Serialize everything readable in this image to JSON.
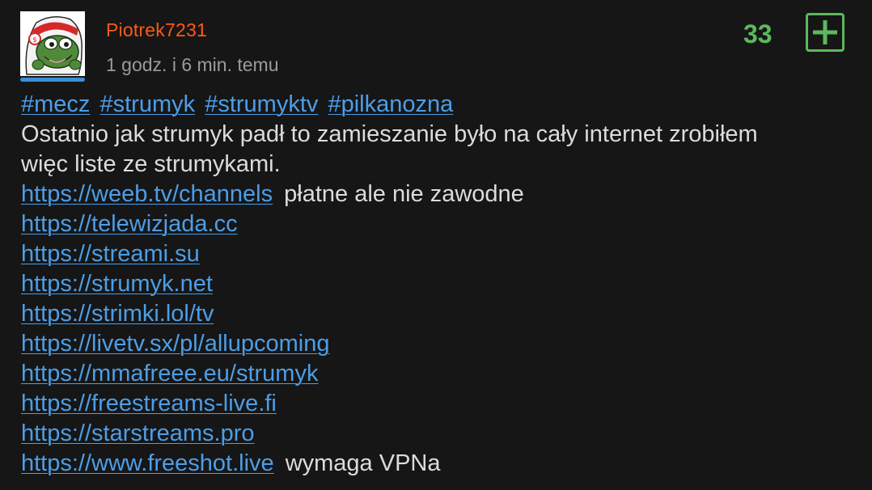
{
  "author": {
    "username": "Piotrek7231",
    "timestamp": "1 godz. i 6 min. temu",
    "avatar_icon": "frog-avatar-icon",
    "username_color": "#ff5917"
  },
  "votes": {
    "count": "33",
    "plus_icon": "plus-icon",
    "color": "#5cb85c"
  },
  "post": {
    "tags": [
      "#mecz",
      "#strumyk",
      "#strumyktv",
      "#pilkanozna"
    ],
    "body_line1": "Ostatnio jak strumyk padł to zamieszanie było na cały internet zrobiłem",
    "body_line2": "więc liste ze strumykami.",
    "links": [
      {
        "url": "https://weeb.tv/channels",
        "note": "płatne ale nie zawodne"
      },
      {
        "url": "https://telewizjada.cc",
        "note": ""
      },
      {
        "url": "https://streami.su",
        "note": ""
      },
      {
        "url": "https://strumyk.net",
        "note": ""
      },
      {
        "url": "https://strimki.lol/tv",
        "note": ""
      },
      {
        "url": "https://livetv.sx/pl/allupcoming",
        "note": ""
      },
      {
        "url": "https://mmafreee.eu/strumyk",
        "note": ""
      },
      {
        "url": "https://freestreams-live.fi",
        "note": ""
      },
      {
        "url": "https://starstreams.pro",
        "note": ""
      },
      {
        "url": "https://www.freeshot.live",
        "note": "wymaga VPNa"
      }
    ],
    "link_color": "#4c9ee8"
  }
}
